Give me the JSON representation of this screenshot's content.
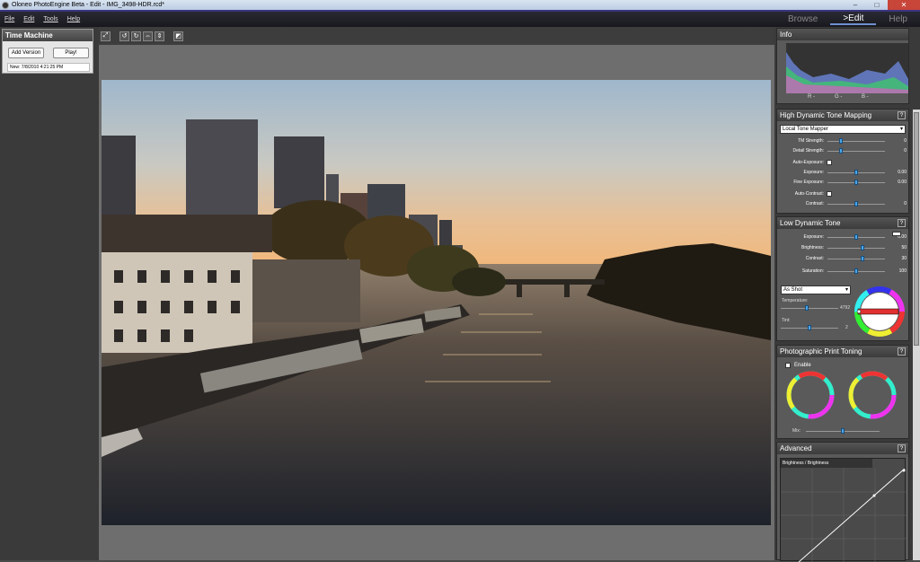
{
  "titlebar": {
    "title": "Oloneo PhotoEngine Beta - Edit - IMG_3498-HDR.rcd*"
  },
  "menu": [
    {
      "label": "File"
    },
    {
      "label": "Edit"
    },
    {
      "label": "Tools"
    },
    {
      "label": "Help"
    }
  ],
  "modes": [
    {
      "label": "Browse"
    },
    {
      "label": ">Edit"
    },
    {
      "label": "Help"
    }
  ],
  "time_machine": {
    "title": "Time Machine",
    "add_version": "Add Version",
    "play": "Play!",
    "status": "New: 7/8/2010 4:21:25 PM"
  },
  "info": {
    "title": "Info",
    "r": "R -",
    "g": "G -",
    "b": "B -"
  },
  "hdr": {
    "title": "High Dynamic Tone Mapping",
    "help": "?",
    "mapper": "Local Tone Mapper",
    "tm_strength": {
      "label": "TM Strength:",
      "value": "0",
      "pct": 0.22
    },
    "detail_strength": {
      "label": "Detail Strength:",
      "value": "0",
      "pct": 0.22
    },
    "auto_exposure": "Auto-Exposure:",
    "exposure": {
      "label": "Exposure:",
      "value": "0.00",
      "pct": 0.5
    },
    "fine_exposure": {
      "label": "Fine Exposure:",
      "value": "0.00",
      "pct": 0.5
    },
    "auto_contrast": "Auto-Contrast:",
    "contrast": {
      "label": "Contrast:",
      "value": "0",
      "pct": 0.5
    }
  },
  "ldr": {
    "title": "Low Dynamic Tone",
    "help": "?",
    "exposure": {
      "label": "Exposure:",
      "value": "0.00",
      "pct": 0.5
    },
    "brightness": {
      "label": "Brightness:",
      "value": "50",
      "pct": 0.62
    },
    "contrast": {
      "label": "Contrast:",
      "value": "30",
      "pct": 0.62
    },
    "saturation": {
      "label": "Saturation:",
      "value": "100",
      "pct": 0.5
    },
    "wb_mode": "As Shot",
    "temperature": {
      "label": "Temperature:",
      "value": "4792",
      "pct": 0.45
    },
    "tint": {
      "label": "Tint:",
      "value": "2",
      "pct": 0.5
    }
  },
  "toning": {
    "title": "Photographic Print Toning",
    "help": "?",
    "enable": "Enable",
    "mix": "Mix:"
  },
  "advanced": {
    "title": "Advanced",
    "help": "?",
    "curve_tab": "Brightness / Brightness"
  },
  "colors": {
    "accent": "#49a5e8",
    "chrome": "#3a3a3a"
  }
}
